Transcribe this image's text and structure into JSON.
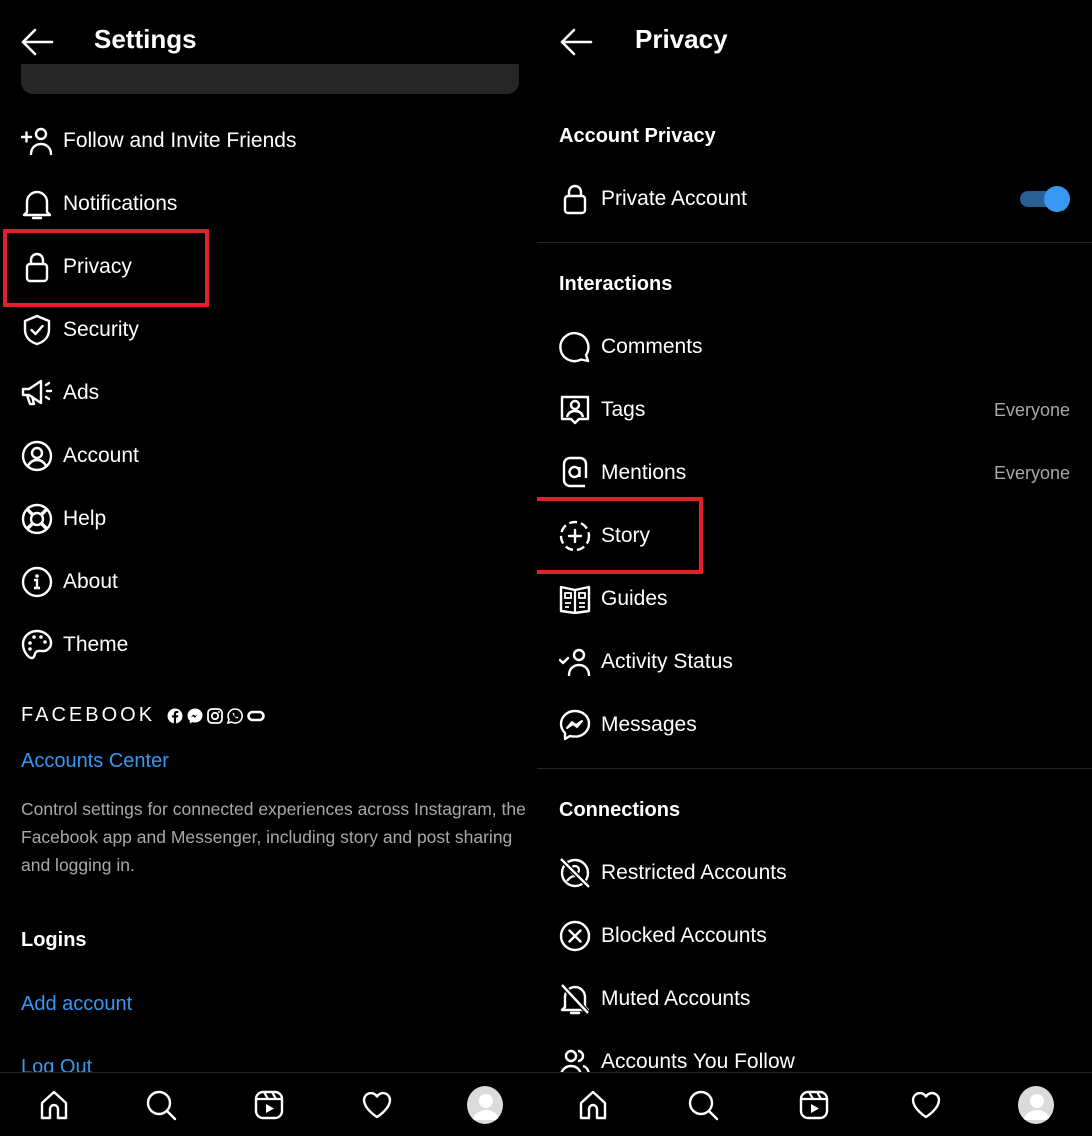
{
  "left": {
    "title": "Settings",
    "menu": [
      {
        "label": "Follow and Invite Friends",
        "icon": "add-person-icon"
      },
      {
        "label": "Notifications",
        "icon": "bell-icon"
      },
      {
        "label": "Privacy",
        "icon": "lock-icon",
        "highlighted": true
      },
      {
        "label": "Security",
        "icon": "shield-check-icon"
      },
      {
        "label": "Ads",
        "icon": "megaphone-icon"
      },
      {
        "label": "Account",
        "icon": "person-circle-icon"
      },
      {
        "label": "Help",
        "icon": "lifebuoy-icon"
      },
      {
        "label": "About",
        "icon": "info-icon"
      },
      {
        "label": "Theme",
        "icon": "palette-icon"
      }
    ],
    "facebook": {
      "wordmark": "FACEBOOK",
      "app_icons": [
        "facebook-icon",
        "messenger-icon",
        "instagram-icon",
        "whatsapp-icon",
        "oculus-icon"
      ],
      "accounts_center": "Accounts Center",
      "description": "Control settings for connected experiences across Instagram, the Facebook app and Messenger, including story and post sharing and logging in."
    },
    "logins": {
      "heading": "Logins",
      "add_account": "Add account",
      "log_out": "Log Out"
    }
  },
  "right": {
    "title": "Privacy",
    "sections": [
      {
        "heading": "Account Privacy",
        "items": [
          {
            "label": "Private Account",
            "icon": "lock-icon",
            "toggle": true
          }
        ]
      },
      {
        "heading": "Interactions",
        "items": [
          {
            "label": "Comments",
            "icon": "comment-icon"
          },
          {
            "label": "Tags",
            "icon": "tag-person-icon",
            "value": "Everyone"
          },
          {
            "label": "Mentions",
            "icon": "at-icon",
            "value": "Everyone"
          },
          {
            "label": "Story",
            "icon": "story-add-icon",
            "highlighted": true
          },
          {
            "label": "Guides",
            "icon": "guides-icon"
          },
          {
            "label": "Activity Status",
            "icon": "activity-status-icon"
          },
          {
            "label": "Messages",
            "icon": "messenger-icon"
          }
        ]
      },
      {
        "heading": "Connections",
        "items": [
          {
            "label": "Restricted Accounts",
            "icon": "restricted-icon"
          },
          {
            "label": "Blocked Accounts",
            "icon": "blocked-icon"
          },
          {
            "label": "Muted Accounts",
            "icon": "muted-bell-icon"
          },
          {
            "label": "Accounts You Follow",
            "icon": "people-icon"
          }
        ]
      }
    ]
  },
  "bottom_nav": [
    "home-icon",
    "search-icon",
    "reels-icon",
    "heart-icon",
    "profile-avatar"
  ],
  "colors": {
    "accent": "#3897f0",
    "highlight_box": "#e0202a",
    "secondary_text": "#a8a8a8",
    "background": "#000000"
  }
}
